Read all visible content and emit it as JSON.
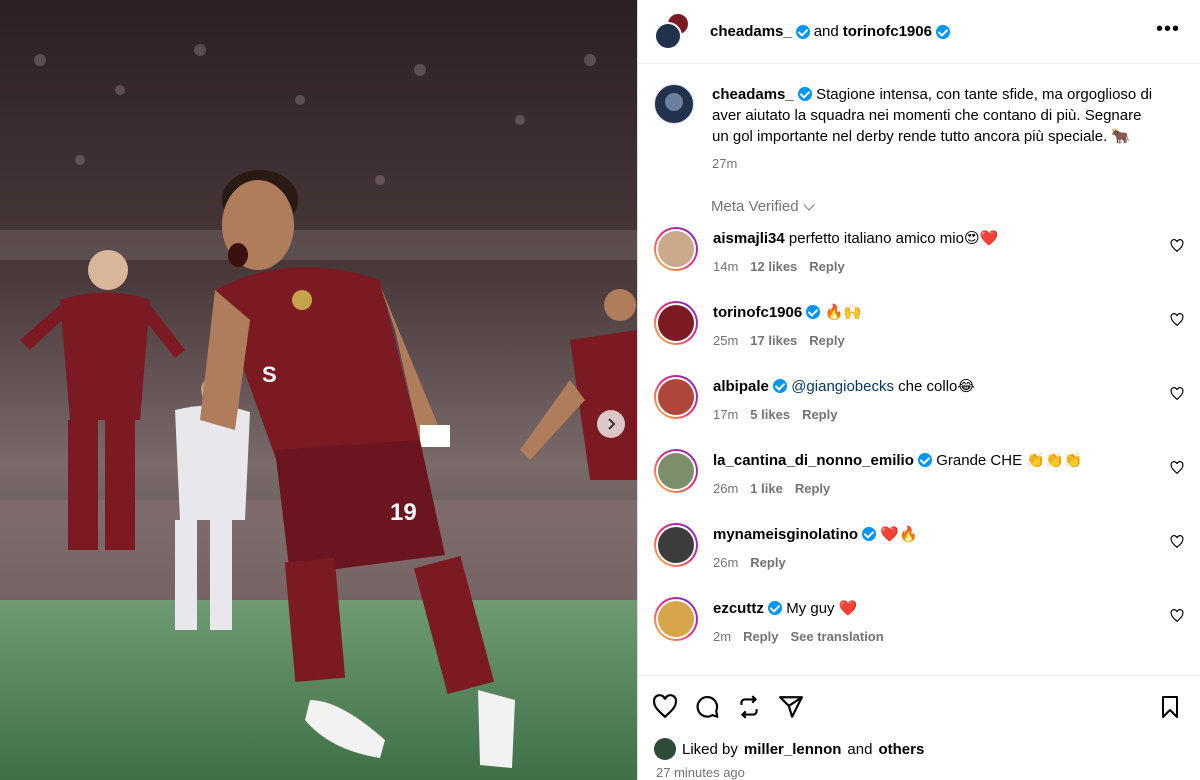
{
  "header": {
    "user1": "cheadams_",
    "and_text": "and",
    "user2": "torinofc1906",
    "more_label": "•••"
  },
  "caption": {
    "username": "cheadams_",
    "text": "Stagione intensa, con tante sfide, ma orgoglioso di aver aiutato la squadra nei momenti che contano di più. Segnare un gol importante nel derby rende tutto ancora più speciale. 🐂",
    "time": "27m",
    "meta_verified": "Meta Verified"
  },
  "comments": [
    {
      "username": "aismajli34",
      "text": "perfetto italiano amico mio😍❤️",
      "time": "14m",
      "likes": "12 likes",
      "reply": "Reply",
      "verified": false,
      "avatar_color": "#c9a98a"
    },
    {
      "username": "torinofc1906",
      "text": "🔥🙌",
      "time": "25m",
      "likes": "17 likes",
      "reply": "Reply",
      "verified": true,
      "avatar_color": "#7b1a22"
    },
    {
      "username": "albipale",
      "mention": "@giangiobecks",
      "text": "che collo😂",
      "time": "17m",
      "likes": "5 likes",
      "reply": "Reply",
      "verified": true,
      "avatar_color": "#b0463a"
    },
    {
      "username": "la_cantina_di_nonno_emilio",
      "text": "Grande CHE 👏👏👏",
      "time": "26m",
      "likes": "1 like",
      "reply": "Reply",
      "verified": true,
      "avatar_color": "#7d8f6a"
    },
    {
      "username": "mynameisginolatino",
      "text": "❤️🔥",
      "time": "26m",
      "likes": "",
      "reply": "Reply",
      "verified": true,
      "avatar_color": "#3c3c3c"
    },
    {
      "username": "ezcuttz",
      "text": "My guy ❤️",
      "time": "2m",
      "likes": "Reply",
      "reply": "See translation",
      "verified": true,
      "avatar_color": "#d7a64a"
    }
  ],
  "footer": {
    "liked_by": "Liked by",
    "liked_user": "miller_lennon",
    "and_others_and": "and",
    "others": "others",
    "timestamp": "27 minutes ago"
  },
  "colors": {
    "verified": "#0095f6",
    "muted": "#737373",
    "jersey": "#7b1a22"
  }
}
